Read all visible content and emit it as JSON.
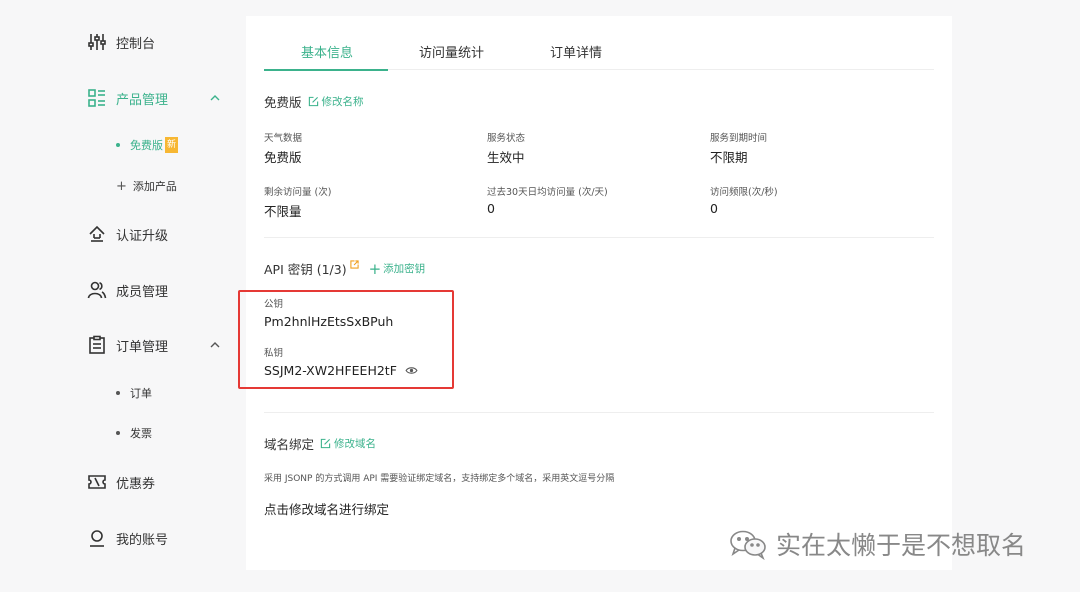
{
  "sidebar": {
    "items": [
      {
        "label": "控制台",
        "icon": "sliders-icon"
      },
      {
        "label": "产品管理",
        "icon": "grid-list-icon",
        "active": true
      },
      {
        "label": "认证升级",
        "icon": "upgrade-icon"
      },
      {
        "label": "成员管理",
        "icon": "users-icon"
      },
      {
        "label": "订单管理",
        "icon": "clipboard-icon"
      },
      {
        "label": "优惠券",
        "icon": "coupon-icon"
      },
      {
        "label": "我的账号",
        "icon": "user-icon"
      }
    ],
    "product_sub": {
      "free_plan": "免费版",
      "new_badge": "新",
      "add_product": "添加产品"
    },
    "order_sub": {
      "orders": "订单",
      "invoice": "发票"
    }
  },
  "tabs": [
    {
      "label": "基本信息",
      "active": true
    },
    {
      "label": "访问量统计"
    },
    {
      "label": "订单详情"
    }
  ],
  "plan": {
    "title": "免费版",
    "edit_label": "修改名称",
    "fields": [
      {
        "label": "天气数据",
        "value": "免费版"
      },
      {
        "label": "服务状态",
        "value": "生效中"
      },
      {
        "label": "服务到期时间",
        "value": "不限期"
      },
      {
        "label": "剩余访问量 (次)",
        "value": "不限量"
      },
      {
        "label": "过去30天日均访问量 (次/天)",
        "value": "0"
      },
      {
        "label": "访问频限(次/秒)",
        "value": "0"
      }
    ]
  },
  "api": {
    "title": "API 密钥 (1/3)",
    "add_label": "添加密钥",
    "public_key_label": "公钥",
    "public_key": "Pm2hnlHzEtsSxBPuh",
    "private_key_label": "私钥",
    "private_key": "SSJM2-XW2HFEEH2tF"
  },
  "domain": {
    "title": "域名绑定",
    "edit_label": "修改域名",
    "description": "采用 JSONP 的方式调用 API 需要验证绑定域名，支持绑定多个域名，采用英文逗号分隔",
    "placeholder": "点击修改域名进行绑定"
  },
  "watermark": "实在太懒于是不想取名",
  "colors": {
    "accent": "#3bb28c",
    "highlight": "#e53935",
    "badge": "#f7b733"
  }
}
